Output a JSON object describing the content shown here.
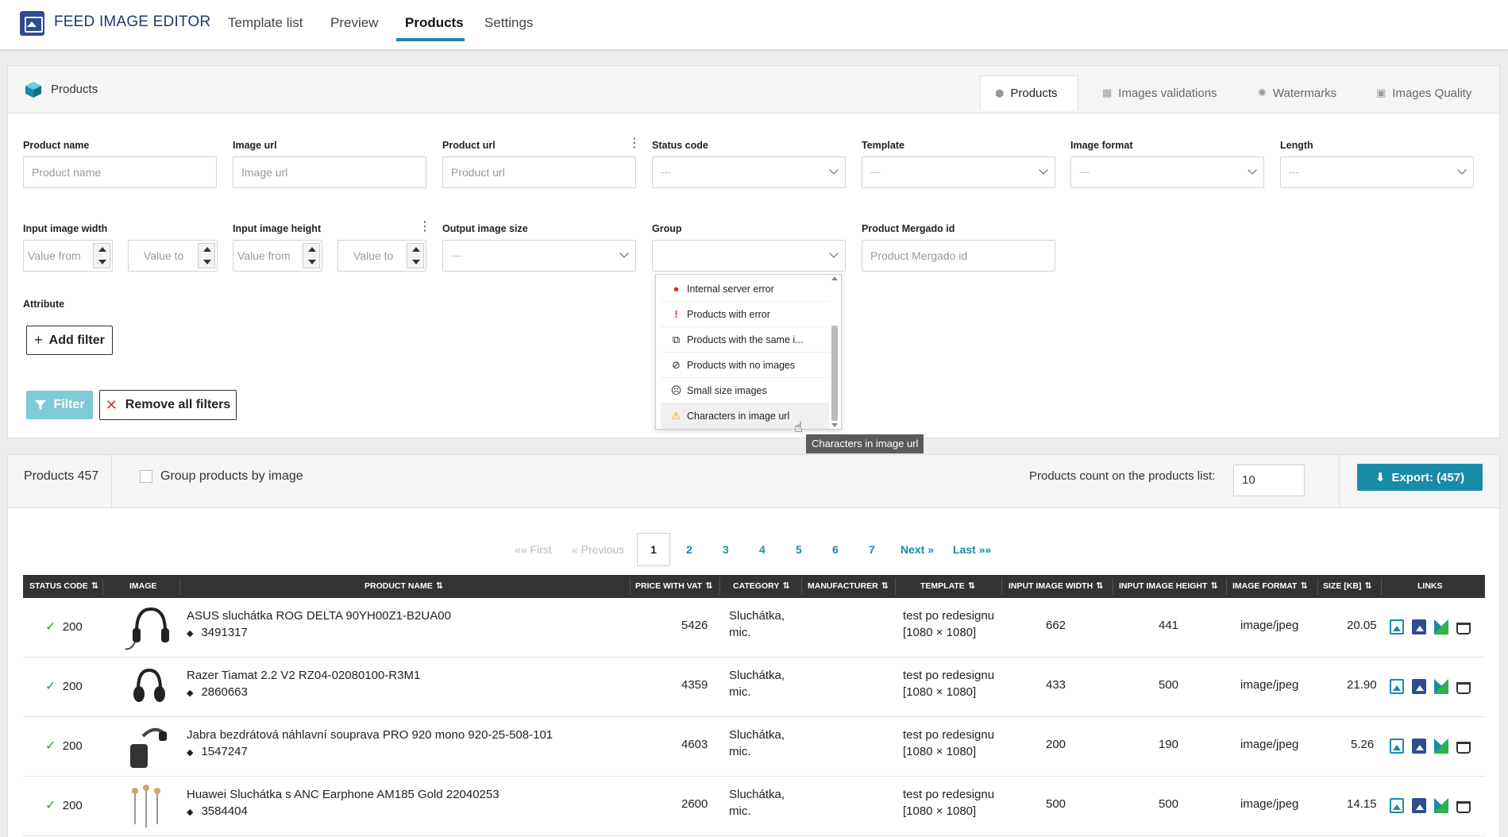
{
  "app": {
    "title": "FEED IMAGE EDITOR"
  },
  "nav": {
    "tabs": [
      {
        "label": "Template list"
      },
      {
        "label": "Preview"
      },
      {
        "label": "Products"
      },
      {
        "label": "Settings"
      }
    ],
    "active": "Products"
  },
  "panel": {
    "title": "Products",
    "tabs": [
      {
        "label": "Products",
        "icon": "box-icon"
      },
      {
        "label": "Images validations",
        "icon": "image-check-icon"
      },
      {
        "label": "Watermarks",
        "icon": "stamp-icon"
      },
      {
        "label": "Images Quality",
        "icon": "image-icon"
      }
    ]
  },
  "filters": {
    "product_name": {
      "label": "Product name",
      "placeholder": "Product name"
    },
    "image_url": {
      "label": "Image url",
      "placeholder": "Image url"
    },
    "product_url": {
      "label": "Product url",
      "placeholder": "Product url"
    },
    "status_code": {
      "label": "Status code",
      "value": "---"
    },
    "template": {
      "label": "Template",
      "value": "---"
    },
    "image_format": {
      "label": "Image format",
      "value": "---"
    },
    "length": {
      "label": "Length",
      "value": "---"
    },
    "input_width": {
      "label": "Input image width",
      "from": "Value from",
      "to": "Value to"
    },
    "input_height": {
      "label": "Input image height",
      "from": "Value from",
      "to": "Value to"
    },
    "output_size": {
      "label": "Output image size",
      "value": "---"
    },
    "group": {
      "label": "Group",
      "value": ""
    },
    "mergado_id": {
      "label": "Product Mergado id",
      "placeholder": "Product Mergado id"
    },
    "attribute": {
      "label": "Attribute"
    },
    "add_filter": "Add filter",
    "filter_btn": "Filter",
    "remove_all": "Remove all filters"
  },
  "group_dropdown": {
    "items": [
      {
        "label": "Internal server error",
        "icon": "error-circle-icon",
        "color": "#e03131"
      },
      {
        "label": "Products with error",
        "icon": "exclamation-icon",
        "color": "#e03131"
      },
      {
        "label": "Products with the same i...",
        "icon": "copy-icon",
        "color": "#333333"
      },
      {
        "label": "Products with no images",
        "icon": "eye-off-icon",
        "color": "#333333"
      },
      {
        "label": "Small size images",
        "icon": "sad-face-icon",
        "color": "#333333"
      },
      {
        "label": "Characters in image url",
        "icon": "warning-icon",
        "color": "#f59f00"
      }
    ],
    "tooltip": "Characters in image url"
  },
  "products_bar": {
    "count_label": "Products 457",
    "group_by_image": "Group products by image",
    "list_count_label": "Products count on the products list:",
    "list_count_value": "10",
    "export": "Export: (457)"
  },
  "pagination": {
    "first": "«« First",
    "previous": "« Previous",
    "pages": [
      "1",
      "2",
      "3",
      "4",
      "5",
      "6",
      "7"
    ],
    "current": "1",
    "next": "Next »",
    "last": "Last »»"
  },
  "table": {
    "columns": [
      "Status code",
      "Image",
      "Product name",
      "Price with VAT",
      "Category",
      "Manufacturer",
      "Template",
      "Input image width",
      "Input image height",
      "Image format",
      "Size [KB]",
      "Links"
    ],
    "rows": [
      {
        "status": "200",
        "name": "ASUS sluchátka ROG DELTA 90YH00Z1-B2UA00",
        "id": "3491317",
        "price": "5426",
        "category1": "Sluchátka,",
        "category2": "mic.",
        "manufacturer": "",
        "template1": "test po redesignu",
        "template2": "[1080 × 1080]",
        "width": "662",
        "height": "441",
        "format": "image/jpeg",
        "size": "20.05"
      },
      {
        "status": "200",
        "name": "Razer Tiamat 2.2 V2 RZ04-02080100-R3M1",
        "id": "2860663",
        "price": "4359",
        "category1": "Sluchátka,",
        "category2": "mic.",
        "manufacturer": "",
        "template1": "test po redesignu",
        "template2": "[1080 × 1080]",
        "width": "433",
        "height": "500",
        "format": "image/jpeg",
        "size": "21.90"
      },
      {
        "status": "200",
        "name": "Jabra bezdrátová náhlavní souprava PRO 920 mono 920-25-508-101",
        "id": "1547247",
        "price": "4603",
        "category1": "Sluchátka,",
        "category2": "mic.",
        "manufacturer": "",
        "template1": "test po redesignu",
        "template2": "[1080 × 1080]",
        "width": "200",
        "height": "190",
        "format": "image/jpeg",
        "size": "5.26"
      },
      {
        "status": "200",
        "name": "Huawei Sluchátka s ANC Earphone AM185 Gold 22040253",
        "id": "3584404",
        "price": "2600",
        "category1": "Sluchátka,",
        "category2": "mic.",
        "manufacturer": "",
        "template1": "test po redesignu",
        "template2": "[1080 × 1080]",
        "width": "500",
        "height": "500",
        "format": "image/jpeg",
        "size": "14.15"
      }
    ]
  },
  "colors": {
    "accent": "#1a8aa9",
    "brand": "#2d4d8e",
    "ok": "#2e9a3a",
    "header_bg": "#333333"
  }
}
